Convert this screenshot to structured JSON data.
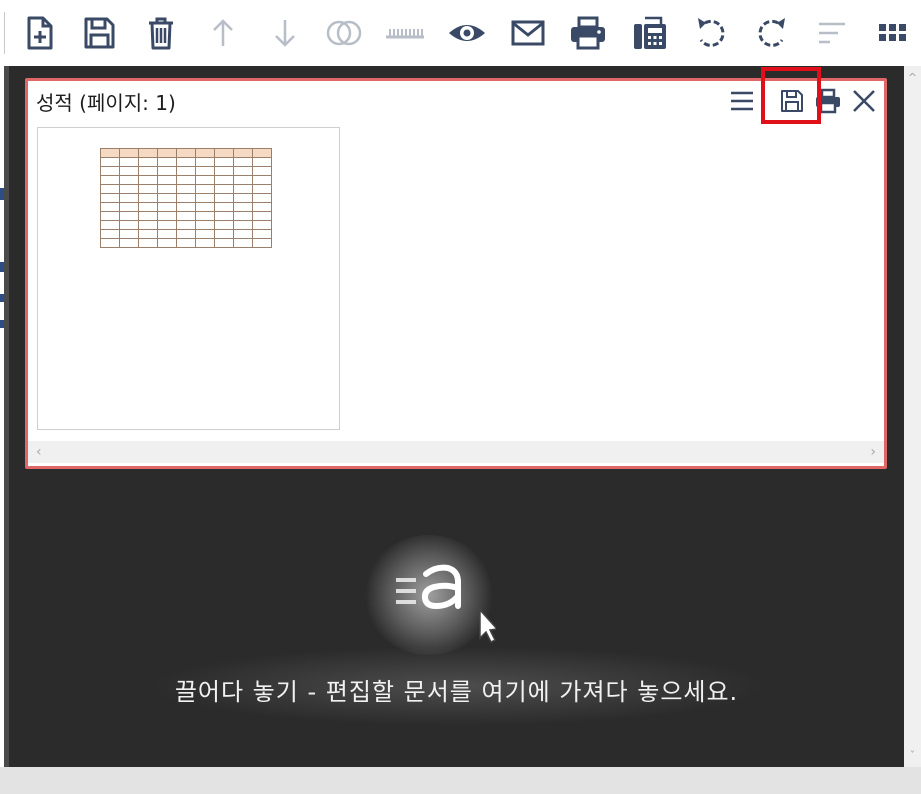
{
  "toolbar": {
    "buttons": [
      {
        "name": "new-document-icon",
        "enabled": true
      },
      {
        "name": "save-icon",
        "enabled": true
      },
      {
        "name": "delete-icon",
        "enabled": true
      },
      {
        "name": "move-up-icon",
        "enabled": false
      },
      {
        "name": "move-down-icon",
        "enabled": false
      },
      {
        "name": "merge-icon",
        "enabled": false
      },
      {
        "name": "split-icon",
        "enabled": false
      },
      {
        "name": "preview-eye-icon",
        "enabled": true
      },
      {
        "name": "mail-icon",
        "enabled": true
      },
      {
        "name": "print-icon",
        "enabled": true
      },
      {
        "name": "fax-icon",
        "enabled": true
      },
      {
        "name": "rotate-left-icon",
        "enabled": true
      },
      {
        "name": "rotate-right-icon",
        "enabled": true
      },
      {
        "name": "sort-icon",
        "enabled": false
      },
      {
        "name": "grid-view-icon",
        "enabled": true
      }
    ]
  },
  "document": {
    "title": "성적 (페이지: 1)",
    "actions": [
      "menu-icon",
      "save-icon",
      "print-icon",
      "close-icon"
    ]
  },
  "drop_zone": {
    "message": "끌어다 놓기 - 편집할 문서를 여기에 가져다 놓으세요."
  },
  "colors": {
    "icon_active": "#3a4a66",
    "icon_disabled": "#b8bec8",
    "panel_border": "#e06767",
    "highlight_box": "#e0101a",
    "workspace_bg": "#2b2b2b"
  }
}
